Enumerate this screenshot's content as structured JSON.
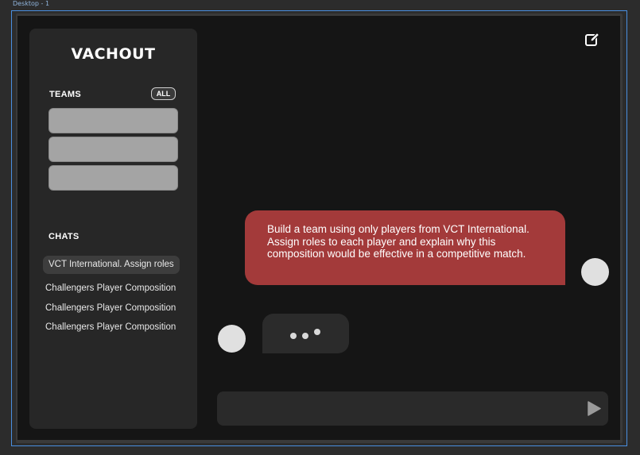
{
  "canvas": {
    "frame_label": "Desktop - 1"
  },
  "sidebar": {
    "logo": "VACHOUT",
    "teams_title": "TEAMS",
    "teams_all_label": "ALL",
    "teams": [
      {
        "name": ""
      },
      {
        "name": ""
      },
      {
        "name": ""
      }
    ],
    "chats_title": "CHATS",
    "chats": [
      {
        "label": "VCT International. Assign roles",
        "active": true
      },
      {
        "label": "Challengers Player Composition",
        "active": false
      },
      {
        "label": "Challengers Player Composition",
        "active": false
      },
      {
        "label": "Challengers Player Composition",
        "active": false
      }
    ]
  },
  "main": {
    "new_chat_icon": "edit-icon",
    "messages": [
      {
        "role": "user",
        "text": "Build a team using only players from VCT International. Assign roles to each player and explain why this composition would be effective in a competitive match."
      },
      {
        "role": "assistant",
        "typing": true
      }
    ],
    "input": {
      "value": "",
      "placeholder": ""
    },
    "send_icon": "play-send-icon"
  },
  "colors": {
    "accent_red": "#a33a3a",
    "sidebar_bg": "#272727",
    "main_bg": "#151515",
    "team_card": "#a4a4a4"
  }
}
